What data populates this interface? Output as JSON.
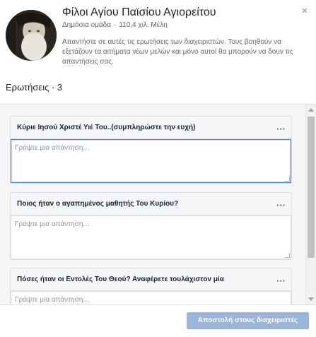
{
  "group": {
    "name": "Φίλοι Αγίου Παϊσίου Αγιορείτου",
    "type": "Δημόσια ομάδα",
    "members": "110,4 χιλ. Μέλη",
    "description": "Απαντήστε σε αυτές τις ερωτήσεις των διαχειριστών. Τους βοηθούν να εξετάζουν τα αιτήματα νέων μελών και μόνο αυτοί θα μπορούν να δουν τις απαντήσεις σας."
  },
  "questions_heading": "Ερωτήσεις · 3",
  "answer_placeholder": "Γράψτε μια απάντηση...",
  "more_icon": "···",
  "close_icon": "×",
  "questions": [
    {
      "text": "Κύριε Ιησού Χριστέ Υιέ Του..(συμπληρώστε την ευχή)",
      "answer": ""
    },
    {
      "text": "Ποιος ήταν ο αγαπημένος μαθητής Του Κυρίου?",
      "answer": ""
    },
    {
      "text": "Πόσες ήταν οι Εντολές Του Θεού? Αναφέρετε τουλάχιστον μία",
      "answer": ""
    }
  ],
  "submit_label": "Αποστολή στους διαχειριστές"
}
